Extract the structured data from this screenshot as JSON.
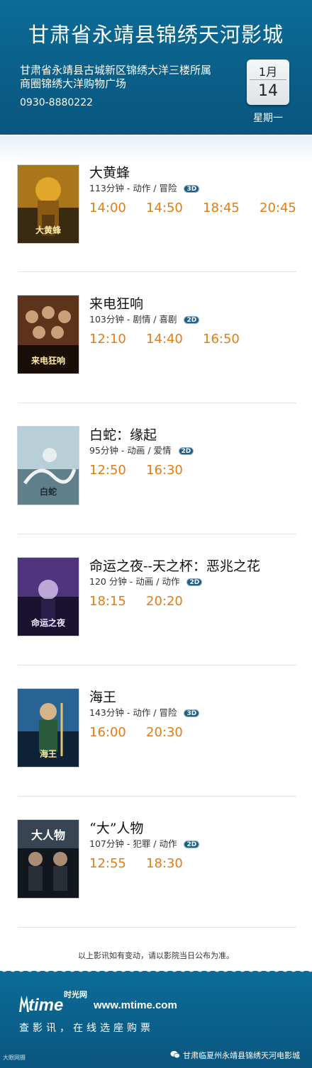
{
  "header": {
    "cinema_name": "甘肃省永靖县锦绣天河影城",
    "address_line1": "甘肃省永靖县古城新区锦绣大洋三楼所属",
    "address_line2": "商圈锦绣大洋购物广场",
    "phone": "0930-8880222",
    "date_month": "1月",
    "date_day": "14",
    "weekday": "星期一"
  },
  "movies": [
    {
      "title": "大黄蜂",
      "meta": "113分钟 - 动作 / 冒险",
      "format": "3D",
      "times": [
        "14:00",
        "14:50",
        "18:45",
        "20:45"
      ],
      "poster_icon": "bumblebee-poster",
      "poster_text": "大黄蜂",
      "poster_colors": [
        "#c58a1c",
        "#3a2a12"
      ]
    },
    {
      "title": "来电狂响",
      "meta": "103分钟 - 剧情 / 喜剧",
      "format": "2D",
      "times": [
        "12:10",
        "14:40",
        "16:50"
      ],
      "poster_icon": "phone-call-poster",
      "poster_text": "来电狂响",
      "poster_colors": [
        "#6b3a1e",
        "#1a0f08"
      ]
    },
    {
      "title": "白蛇：缘起",
      "meta": "95分钟 - 动画 / 爱情",
      "format": "2D",
      "times": [
        "12:50",
        "16:30"
      ],
      "poster_icon": "white-snake-poster",
      "poster_text": "白蛇",
      "poster_colors": [
        "#b9cfd8",
        "#4a6a78"
      ]
    },
    {
      "title": "命运之夜--天之杯：恶兆之花",
      "meta": "120 分钟 - 动画 / 动作",
      "format": "2D",
      "times": [
        "18:15",
        "20:20"
      ],
      "poster_icon": "fate-poster",
      "poster_text": "命运之夜",
      "poster_colors": [
        "#5b3b8c",
        "#1b1230"
      ]
    },
    {
      "title": "海王",
      "meta": "143分钟 - 动作 / 冒险",
      "format": "3D",
      "times": [
        "16:00",
        "20:30"
      ],
      "poster_icon": "aquaman-poster",
      "poster_text": "海王",
      "poster_colors": [
        "#2d6fa3",
        "#0f2338"
      ]
    },
    {
      "title": "“大”人物",
      "meta": "107分钟 - 犯罪 / 动作",
      "format": "2D",
      "times": [
        "12:55",
        "18:30"
      ],
      "poster_icon": "big-shot-poster",
      "poster_text": "大人物",
      "poster_colors": [
        "#3b4a58",
        "#11171d"
      ]
    }
  ],
  "notice": "以上影讯如有变动，请以影院当日公布为准。",
  "footer": {
    "logo_cn": "时光网",
    "logo_en": "time",
    "site": "www.mtime.com",
    "slogan": "查影讯，在线选座购票",
    "watermark": "大眼网摄",
    "account": "甘肃临夏州永靖县锦绣天河电影城"
  },
  "colors": {
    "header_bg": "#0a5f88",
    "showtime": "#e47c16",
    "badge_bg": "#1f5f86"
  }
}
